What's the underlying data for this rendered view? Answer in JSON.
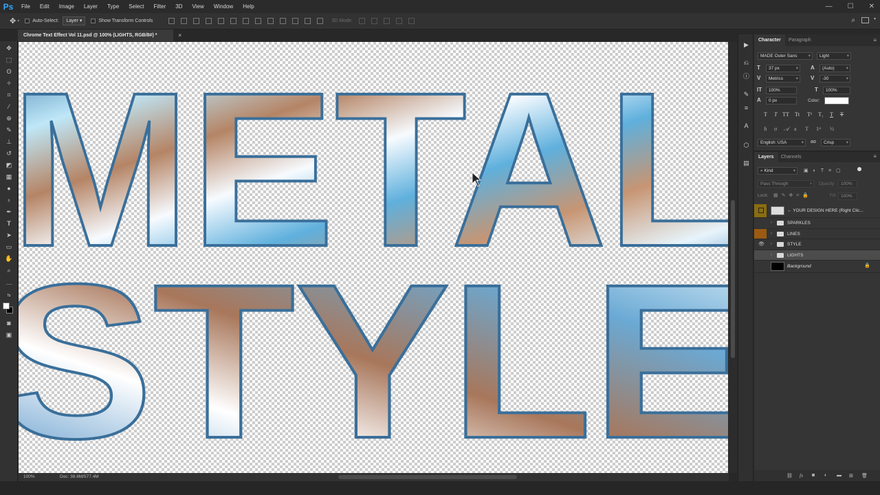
{
  "app": {
    "logo": "Ps"
  },
  "menu": [
    "File",
    "Edit",
    "Image",
    "Layer",
    "Type",
    "Select",
    "Filter",
    "3D",
    "View",
    "Window",
    "Help"
  ],
  "window_controls": [
    "—",
    "☐",
    "✕"
  ],
  "options_bar": {
    "auto_select_label": "Auto-Select:",
    "auto_select_value": "Layer",
    "transform_label": "Show Transform Controls",
    "mode_3d_label": "3D Mode:"
  },
  "document": {
    "tab_title": "Chrome Text Effect Vol 11.psd @ 100% (LIGHTS, RGB/8#) *",
    "close": "×",
    "canvas_words": [
      "METAL",
      "STYLE"
    ]
  },
  "status": {
    "zoom": "100%",
    "doc_size": "Doc: 38.6M/577.4M"
  },
  "character": {
    "tabs": [
      "Character",
      "Paragraph"
    ],
    "font_family": "MADE Outer Sans",
    "font_style": "Light",
    "size": "37 px",
    "leading": "(Auto)",
    "kerning": "Metrics",
    "tracking": "-30",
    "v_scale": "100%",
    "h_scale": "100%",
    "baseline": "0 px",
    "color_label": "Color:",
    "color_value": "#ffffff",
    "style_buttons": [
      "T",
      "T",
      "TT",
      "Tt",
      "T¹",
      "T₁",
      "T",
      "T"
    ],
    "language": "English: USA",
    "aa_label": "aɑ",
    "antialias": "Crisp"
  },
  "layers": {
    "tabs": [
      "Layers",
      "Channels"
    ],
    "filter_kind": "Kind",
    "blend_mode": "Pass Through",
    "opacity_label": "Opacity:",
    "opacity": "100%",
    "lock_label": "Lock:",
    "fill_label": "Fill:",
    "fill": "100%",
    "items": [
      {
        "name": "← YOUR DESIGN HERE (Right Clic...",
        "type": "smart",
        "color": "#8a6d10",
        "visible": false
      },
      {
        "name": "SPARKLES",
        "type": "group",
        "color": "",
        "visible": false
      },
      {
        "name": "LINES",
        "type": "group",
        "color": "#9a5a12",
        "visible": false
      },
      {
        "name": "STYLE",
        "type": "group",
        "color": "",
        "visible": true
      },
      {
        "name": "LIGHTS",
        "type": "group",
        "color": "",
        "visible": false,
        "selected": true
      },
      {
        "name": "Background",
        "type": "background",
        "color": "",
        "visible": false
      }
    ]
  },
  "colors": {
    "accent": "#31a8ff",
    "chrome_blue": "#4fa8d8",
    "chrome_copper": "#b07a55"
  }
}
